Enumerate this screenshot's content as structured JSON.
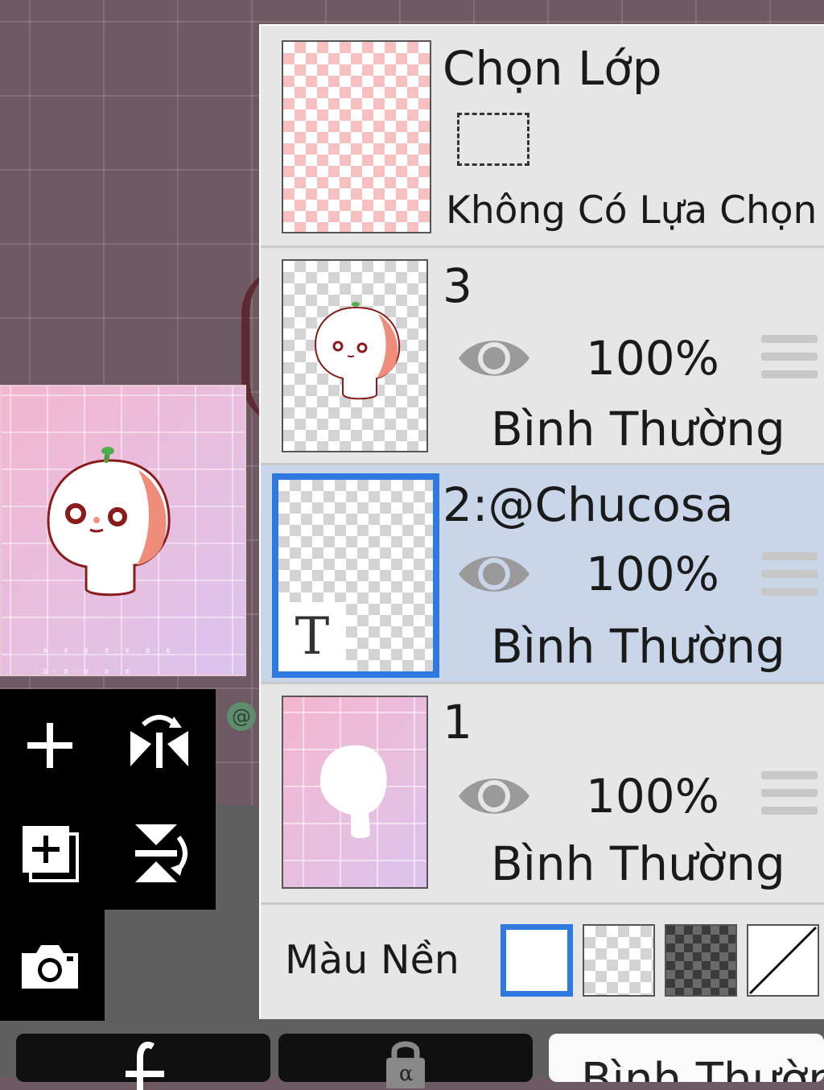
{
  "layer_panel": {
    "selection_layer": {
      "title": "Chọn Lớp",
      "status": "Không Có Lựa Chọn"
    },
    "layers": [
      {
        "name": "3",
        "opacity": "100%",
        "blend_mode": "Bình Thường",
        "visible": true,
        "selected": false
      },
      {
        "name": "2:@Chucosa",
        "opacity": "100%",
        "blend_mode": "Bình Thường",
        "visible": true,
        "selected": true,
        "text_thumb_glyph": "T"
      },
      {
        "name": "1",
        "opacity": "100%",
        "blend_mode": "Bình Thường",
        "visible": true,
        "selected": false
      }
    ],
    "background": {
      "label": "Màu Nền",
      "options": [
        "white",
        "transparent-checker",
        "dark-checker",
        "none"
      ],
      "selected": "white"
    }
  },
  "toolbar": {
    "icons": [
      "add-layer-icon",
      "flip-horizontal-icon",
      "duplicate-layer-icon",
      "flip-vertical-icon",
      "camera-icon"
    ]
  },
  "bottom_bar": {
    "blend_mode_label": "Bình Thường"
  },
  "colors": {
    "selection_blue": "#2f79e0",
    "selected_row_bg": "#c9d6ea",
    "canvas_bg": "#6e5862",
    "panel_bg": "#e6e6e6"
  }
}
